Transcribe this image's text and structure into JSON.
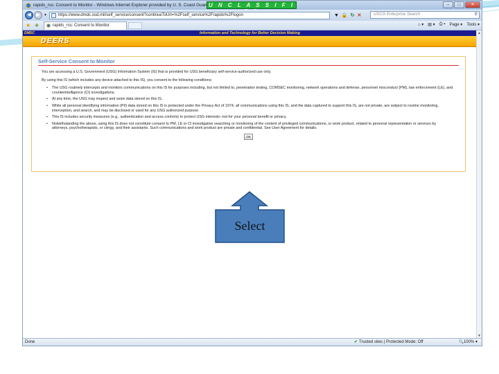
{
  "browser": {
    "window_title": "rapids_rss: Consent to Monitor - Windows Internet Explorer provided by U. S. Coast Guard",
    "classification": "U N C L A S S I F I E D",
    "url": "https://www.dmdc.osd.mil/self_service/consent?continueToUrl=%2Fself_service%2Frapids%2Flogon",
    "search_placeholder": "USCG Enterprise Search",
    "tab_label": "rapids_rss: Consent to Monitor",
    "command_bar": [
      "Page ▾",
      "Tools ▾"
    ],
    "status_left": "Done",
    "status_zone": "Trusted sites | Protected Mode: Off",
    "status_zoom": "100%"
  },
  "site": {
    "org_logo": "DMDC",
    "tagline": "Information and Technology for Better Decision Making",
    "app_logo": "DEERS"
  },
  "consent": {
    "title": "Self-Service Consent to Monitor",
    "intro": "You are accessing a U.S. Government (USG) Information System (IS) that is provided for USG beneficiary self-service-authorized use only.",
    "lead": "By using this IS (which includes any device attached to this IS), you consent to the following conditions:",
    "conditions": [
      "The USG routinely intercepts and monitors communications on this IS for purposes including, but not limited to, penetration testing, COMSEC monitoring, network operations and defense, personnel misconduct (PM), law enforcement (LE), and counterintelligence (CI) investigations.",
      "At any time, the USG may inspect and seize data stored on this IS.",
      "While all personal identifying information (PII) data stored on this IS is protected under the Privacy Act of 1974, all communications using this IS, and the data captured to support this IS, are not private, are subject to routine monitoring, interception, and search, and may be disclosed or used for any USG authorized purpose.",
      "This IS includes security measures (e.g., authentication and access controls) to protect USG interests--not for your personal benefit or privacy.",
      "Notwithstanding the above, using this IS does not constitute consent to PM, LE or CI investigative searching or monitoring of the content of privileged communications, or work product, related to personal representation or services by attorneys, psychotherapists, or clergy, and their assistants. Such communications and work product are private and confidential. See User Agreement for details."
    ],
    "ok_label": "OK"
  },
  "annotation": {
    "callout_label": "Select",
    "callout_fill": "#4a7ebb",
    "callout_border": "#1f4e8a"
  }
}
